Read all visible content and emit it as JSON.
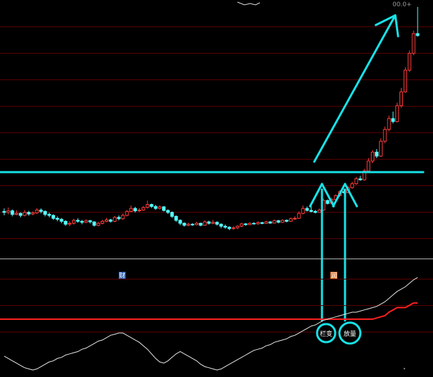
{
  "chart_data": {
    "type": "candlestick",
    "candles": [
      [
        9.55,
        9.5,
        9.7,
        9.35
      ],
      [
        9.5,
        9.58,
        9.75,
        9.4
      ],
      [
        9.58,
        9.4,
        9.65,
        9.3
      ],
      [
        9.4,
        9.45,
        9.6,
        9.35
      ],
      [
        9.45,
        9.35,
        9.5,
        9.25
      ],
      [
        9.35,
        9.5,
        9.62,
        9.3
      ],
      [
        9.5,
        9.42,
        9.58,
        9.33
      ],
      [
        9.42,
        9.48,
        9.55,
        9.35
      ],
      [
        9.48,
        9.62,
        9.72,
        9.42
      ],
      [
        9.62,
        9.55,
        9.7,
        9.45
      ],
      [
        9.55,
        9.4,
        9.6,
        9.3
      ],
      [
        9.4,
        9.35,
        9.48,
        9.25
      ],
      [
        9.35,
        9.2,
        9.4,
        9.12
      ],
      [
        9.2,
        9.15,
        9.3,
        9.05
      ],
      [
        9.15,
        9.05,
        9.22,
        8.95
      ],
      [
        9.05,
        8.9,
        9.1,
        8.82
      ],
      [
        8.9,
        8.95,
        9.05,
        8.8
      ],
      [
        8.95,
        9.1,
        9.18,
        8.88
      ],
      [
        9.1,
        9.05,
        9.2,
        8.98
      ],
      [
        9.05,
        9.0,
        9.12,
        8.9
      ],
      [
        9.0,
        9.08,
        9.15,
        8.95
      ],
      [
        9.08,
        9.02,
        9.12,
        8.94
      ],
      [
        9.02,
        8.85,
        9.05,
        8.78
      ],
      [
        8.85,
        8.95,
        9.02,
        8.8
      ],
      [
        8.95,
        9.05,
        9.12,
        8.9
      ],
      [
        9.05,
        9.12,
        9.22,
        9.0
      ],
      [
        9.12,
        9.05,
        9.18,
        8.98
      ],
      [
        9.05,
        9.25,
        9.32,
        9.0
      ],
      [
        9.25,
        9.18,
        9.35,
        9.1
      ],
      [
        9.18,
        9.35,
        9.45,
        9.12
      ],
      [
        9.35,
        9.55,
        9.62,
        9.3
      ],
      [
        9.55,
        9.7,
        9.85,
        9.5
      ],
      [
        9.7,
        9.58,
        9.78,
        9.5
      ],
      [
        9.58,
        9.62,
        9.72,
        9.52
      ],
      [
        9.62,
        9.75,
        9.82,
        9.58
      ],
      [
        9.75,
        9.9,
        10.1,
        9.7
      ],
      [
        9.9,
        9.8,
        9.95,
        9.72
      ],
      [
        9.8,
        9.7,
        9.88,
        9.62
      ],
      [
        9.7,
        9.78,
        9.85,
        9.65
      ],
      [
        9.78,
        9.6,
        9.82,
        9.55
      ],
      [
        9.6,
        9.5,
        9.65,
        9.42
      ],
      [
        9.5,
        9.3,
        9.55,
        9.22
      ],
      [
        9.3,
        9.1,
        9.35,
        9.02
      ],
      [
        9.1,
        8.95,
        9.15,
        8.85
      ],
      [
        8.95,
        8.85,
        9.0,
        8.78
      ],
      [
        8.85,
        8.9,
        8.98,
        8.8
      ],
      [
        8.9,
        8.88,
        8.95,
        8.82
      ],
      [
        8.88,
        8.95,
        9.02,
        8.84
      ],
      [
        8.95,
        8.85,
        8.98,
        8.8
      ],
      [
        8.85,
        9.02,
        9.1,
        8.82
      ],
      [
        9.02,
        8.95,
        9.08,
        8.88
      ],
      [
        8.95,
        9.0,
        9.12,
        8.9
      ],
      [
        9.0,
        8.9,
        9.05,
        8.84
      ],
      [
        8.9,
        8.8,
        8.95,
        8.7
      ],
      [
        8.8,
        8.75,
        8.88,
        8.68
      ],
      [
        8.75,
        8.68,
        8.8,
        8.6
      ],
      [
        8.68,
        8.72,
        8.8,
        8.62
      ],
      [
        8.72,
        8.8,
        8.85,
        8.65
      ],
      [
        8.8,
        8.92,
        8.98,
        8.75
      ],
      [
        8.92,
        8.88,
        8.96,
        8.82
      ],
      [
        8.88,
        8.95,
        9.0,
        8.85
      ],
      [
        8.95,
        8.92,
        9.0,
        8.88
      ],
      [
        8.92,
        8.98,
        9.05,
        8.88
      ],
      [
        8.98,
        8.94,
        9.02,
        8.9
      ],
      [
        8.94,
        9.02,
        9.08,
        8.92
      ],
      [
        9.02,
        8.96,
        9.06,
        8.92
      ],
      [
        8.96,
        9.08,
        9.14,
        8.94
      ],
      [
        9.08,
        9.0,
        9.12,
        8.95
      ],
      [
        9.0,
        9.1,
        9.15,
        8.96
      ],
      [
        9.1,
        9.05,
        9.14,
        9.0
      ],
      [
        9.05,
        9.18,
        9.24,
        9.02
      ],
      [
        9.18,
        9.2,
        9.3,
        9.12
      ],
      [
        9.2,
        9.45,
        9.55,
        9.18
      ],
      [
        9.45,
        9.7,
        9.85,
        9.4
      ],
      [
        9.7,
        9.6,
        9.8,
        9.55
      ],
      [
        9.6,
        9.55,
        9.9,
        9.5
      ],
      [
        9.55,
        9.5,
        9.62,
        9.45
      ],
      [
        9.5,
        9.62,
        9.7,
        9.48
      ],
      [
        9.62,
        10.1,
        10.2,
        9.58
      ],
      [
        10.1,
        9.95,
        10.15,
        9.9
      ],
      [
        9.95,
        10.15,
        10.25,
        9.92
      ],
      [
        10.15,
        10.35,
        10.42,
        10.1
      ],
      [
        10.35,
        10.55,
        10.62,
        10.3
      ],
      [
        10.55,
        10.5,
        10.68,
        10.45
      ],
      [
        10.5,
        10.75,
        10.82,
        10.48
      ],
      [
        10.75,
        10.95,
        11.05,
        10.7
      ],
      [
        10.95,
        11.2,
        11.3,
        10.9
      ],
      [
        11.2,
        11.15,
        11.35,
        11.1
      ],
      [
        11.15,
        11.6,
        11.7,
        11.1
      ],
      [
        11.6,
        12.1,
        12.25,
        11.55
      ],
      [
        12.1,
        12.55,
        12.65,
        12.0
      ],
      [
        12.55,
        12.35,
        12.7,
        12.25
      ],
      [
        12.35,
        13.1,
        13.25,
        12.3
      ],
      [
        13.1,
        13.7,
        13.85,
        13.0
      ],
      [
        13.7,
        14.25,
        14.4,
        13.6
      ],
      [
        14.25,
        14.1,
        14.6,
        14.0
      ],
      [
        14.1,
        14.9,
        15.05,
        14.05
      ],
      [
        14.9,
        15.6,
        15.8,
        14.8
      ],
      [
        15.6,
        16.7,
        16.85,
        15.55
      ],
      [
        16.7,
        17.55,
        17.7,
        16.6
      ],
      [
        17.55,
        18.55,
        18.7,
        17.45
      ],
      [
        18.55,
        18.45,
        19.9,
        18.4
      ]
    ],
    "ylim": [
      7.2,
      20.25
    ],
    "indicator": {
      "white_line": [
        0.68,
        0.66,
        0.64,
        0.62,
        0.6,
        0.58,
        0.57,
        0.56,
        0.57,
        0.59,
        0.61,
        0.63,
        0.64,
        0.66,
        0.67,
        0.69,
        0.7,
        0.71,
        0.72,
        0.74,
        0.75,
        0.77,
        0.79,
        0.81,
        0.82,
        0.84,
        0.86,
        0.87,
        0.88,
        0.88,
        0.86,
        0.84,
        0.82,
        0.8,
        0.77,
        0.74,
        0.7,
        0.66,
        0.63,
        0.62,
        0.64,
        0.67,
        0.7,
        0.72,
        0.7,
        0.68,
        0.66,
        0.64,
        0.61,
        0.59,
        0.58,
        0.57,
        0.56,
        0.57,
        0.59,
        0.61,
        0.63,
        0.65,
        0.67,
        0.69,
        0.71,
        0.73,
        0.74,
        0.75,
        0.77,
        0.78,
        0.8,
        0.81,
        0.82,
        0.83,
        0.85,
        0.86,
        0.88,
        0.9,
        0.92,
        0.94,
        0.95,
        0.97,
        0.99,
        1.0,
        1.01,
        1.02,
        1.03,
        1.04,
        1.05,
        1.06,
        1.06,
        1.07,
        1.08,
        1.09,
        1.1,
        1.11,
        1.13,
        1.15,
        1.18,
        1.21,
        1.24,
        1.26,
        1.28,
        1.31,
        1.34,
        1.36
      ],
      "red_line": [
        null,
        null,
        null,
        null,
        null,
        null,
        null,
        null,
        null,
        null,
        null,
        null,
        null,
        null,
        null,
        null,
        null,
        null,
        null,
        null,
        null,
        null,
        null,
        null,
        null,
        null,
        null,
        null,
        null,
        null,
        null,
        null,
        null,
        null,
        null,
        null,
        null,
        null,
        null,
        null,
        null,
        null,
        null,
        null,
        null,
        null,
        null,
        null,
        null,
        null,
        null,
        null,
        null,
        null,
        null,
        null,
        null,
        null,
        null,
        null,
        null,
        null,
        null,
        null,
        null,
        null,
        null,
        null,
        null,
        null,
        null,
        null,
        null,
        null,
        null,
        null,
        null,
        null,
        null,
        null,
        null,
        null,
        null,
        null,
        null,
        null,
        null,
        null,
        null,
        null,
        1.0,
        1.01,
        1.02,
        1.03,
        1.06,
        1.08,
        1.1,
        1.1,
        1.1,
        1.12,
        1.14,
        1.14
      ],
      "ylim": [
        0.5,
        1.5
      ]
    }
  },
  "colors": {
    "background": "#000000",
    "up_candle": "#ff3c3c",
    "down_candle": "#54ffff",
    "annotation": "#18e2e8",
    "indicator_line": "#e8e8e8",
    "signal_line": "#ff2020",
    "grid_red": "#5a0000",
    "divider": "#b4b4b4",
    "flag_blue": "#2d5fb4",
    "flag_orange": "#dc7832"
  },
  "top_edge_readout": "00.0+",
  "signal_labels": [
    "栏变",
    "放量"
  ],
  "markers": [
    "财",
    "润"
  ]
}
